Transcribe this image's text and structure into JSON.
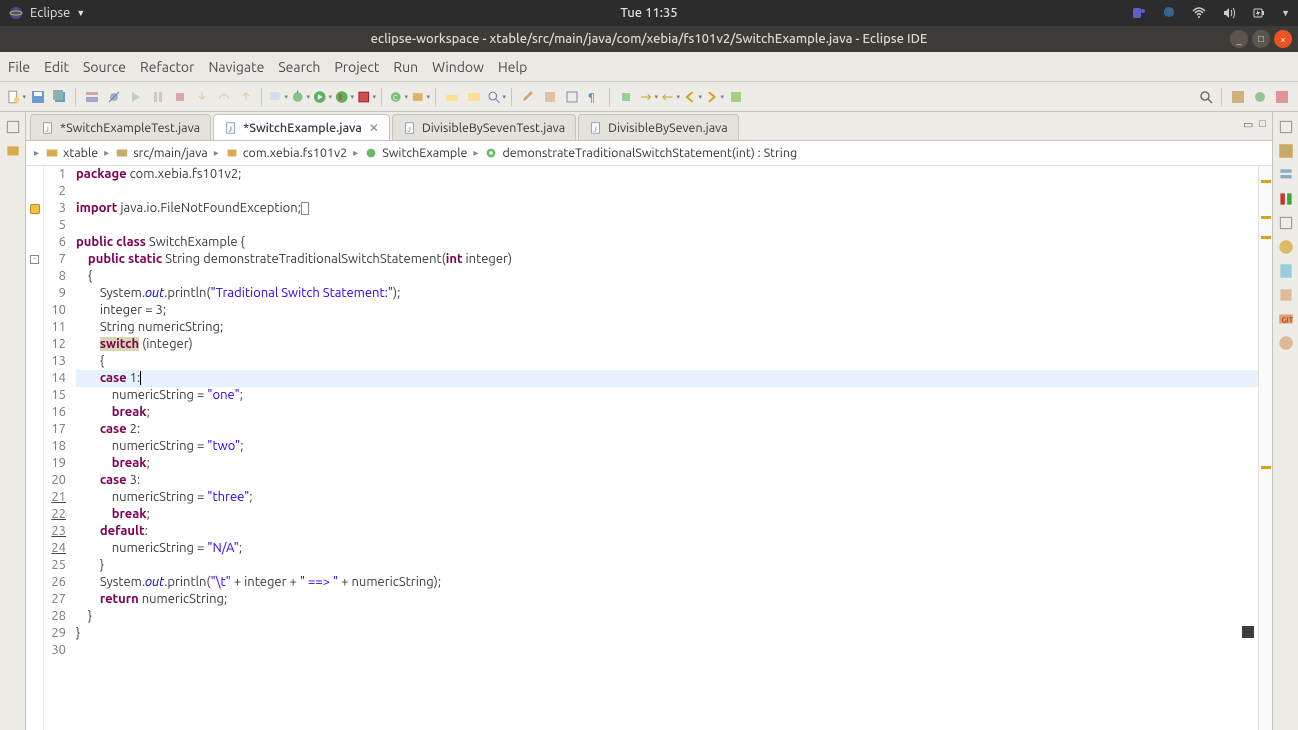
{
  "topbar": {
    "app": "Eclipse",
    "clock": "Tue 11:35"
  },
  "window": {
    "title": "eclipse-workspace - xtable/src/main/java/com/xebia/fs101v2/SwitchExample.java - Eclipse IDE"
  },
  "menu": [
    "File",
    "Edit",
    "Source",
    "Refactor",
    "Navigate",
    "Search",
    "Project",
    "Run",
    "Window",
    "Help"
  ],
  "tabs": [
    {
      "label": "*SwitchExampleTest.java",
      "active": false
    },
    {
      "label": "*SwitchExample.java",
      "active": true
    },
    {
      "label": "DivisibleBySevenTest.java",
      "active": false
    },
    {
      "label": "DivisibleBySeven.java",
      "active": false
    }
  ],
  "breadcrumb": {
    "project": "xtable",
    "srcfolder": "src/main/java",
    "pkg": "com.xebia.fs101v2",
    "cls": "SwitchExample",
    "method": "demonstrateTraditionalSwitchStatement(int) : String"
  },
  "code": {
    "lines": [
      {
        "n": 1,
        "tokens": [
          [
            "kw",
            "package"
          ],
          [
            "",
            " com.xebia.fs101v2;"
          ]
        ]
      },
      {
        "n": 2,
        "tokens": [
          [
            "",
            ""
          ]
        ]
      },
      {
        "n": 3,
        "marker": "warn-plus",
        "tokens": [
          [
            "kw",
            "import"
          ],
          [
            "",
            " java.io.FileNotFoundException;"
          ],
          [
            "box",
            "▯"
          ]
        ]
      },
      {
        "n": 5,
        "tokens": [
          [
            "",
            ""
          ]
        ]
      },
      {
        "n": 6,
        "tokens": [
          [
            "kw",
            "public"
          ],
          [
            "",
            " "
          ],
          [
            "kw",
            "class"
          ],
          [
            "",
            " SwitchExample {"
          ]
        ]
      },
      {
        "n": 7,
        "marker": "fold",
        "tokens": [
          [
            "",
            "    "
          ],
          [
            "kw",
            "public"
          ],
          [
            "",
            " "
          ],
          [
            "kw",
            "static"
          ],
          [
            "",
            " String demonstrateTraditionalSwitchStatement("
          ],
          [
            "kw",
            "int"
          ],
          [
            "",
            " integer)"
          ]
        ]
      },
      {
        "n": 8,
        "tokens": [
          [
            "",
            "    {"
          ]
        ]
      },
      {
        "n": 9,
        "tokens": [
          [
            "",
            "        System."
          ],
          [
            "fld",
            "out"
          ],
          [
            "",
            ".println("
          ],
          [
            "str",
            "\"Traditional Switch Statement:\""
          ],
          [
            "",
            ");"
          ]
        ]
      },
      {
        "n": 10,
        "tokens": [
          [
            "",
            "        integer = 3;"
          ]
        ]
      },
      {
        "n": 11,
        "tokens": [
          [
            "",
            "        String numericString;"
          ]
        ]
      },
      {
        "n": 12,
        "tokens": [
          [
            "",
            "        "
          ],
          [
            "switchbox",
            "switch"
          ],
          [
            "",
            " (integer)"
          ]
        ]
      },
      {
        "n": 13,
        "tokens": [
          [
            "",
            "        {"
          ]
        ]
      },
      {
        "n": 14,
        "hl": true,
        "tokens": [
          [
            "",
            "        "
          ],
          [
            "kw",
            "case"
          ],
          [
            "",
            " 1:"
          ],
          [
            "cursor",
            "|"
          ]
        ]
      },
      {
        "n": 15,
        "tokens": [
          [
            "",
            "            numericString = "
          ],
          [
            "str",
            "\"one\""
          ],
          [
            "",
            ";"
          ]
        ]
      },
      {
        "n": 16,
        "tokens": [
          [
            "",
            "            "
          ],
          [
            "kw",
            "break"
          ],
          [
            "",
            ";"
          ]
        ]
      },
      {
        "n": 17,
        "tokens": [
          [
            "",
            "        "
          ],
          [
            "kw",
            "case"
          ],
          [
            "",
            " 2:"
          ]
        ]
      },
      {
        "n": 18,
        "tokens": [
          [
            "",
            "            numericString = "
          ],
          [
            "str",
            "\"two\""
          ],
          [
            "",
            ";"
          ]
        ]
      },
      {
        "n": 19,
        "tokens": [
          [
            "",
            "            "
          ],
          [
            "kw",
            "break"
          ],
          [
            "",
            ";"
          ]
        ]
      },
      {
        "n": 20,
        "tokens": [
          [
            "",
            "        "
          ],
          [
            "kw",
            "case"
          ],
          [
            "",
            " 3:"
          ]
        ]
      },
      {
        "n": 21,
        "tokens": [
          [
            "",
            "            numericString = "
          ],
          [
            "str",
            "\"three\""
          ],
          [
            "",
            ";"
          ]
        ]
      },
      {
        "n": 22,
        "tokens": [
          [
            "",
            "            "
          ],
          [
            "kw",
            "break"
          ],
          [
            "",
            ";"
          ]
        ]
      },
      {
        "n": 23,
        "tokens": [
          [
            "",
            "        "
          ],
          [
            "kw",
            "default"
          ],
          [
            "",
            ":"
          ]
        ]
      },
      {
        "n": 24,
        "tokens": [
          [
            "",
            "            numericString = "
          ],
          [
            "str",
            "\"N/A\""
          ],
          [
            "",
            ";"
          ]
        ]
      },
      {
        "n": 25,
        "tokens": [
          [
            "",
            "        }"
          ]
        ]
      },
      {
        "n": 26,
        "tokens": [
          [
            "",
            "        System."
          ],
          [
            "fld",
            "out"
          ],
          [
            "",
            ".println("
          ],
          [
            "str",
            "\"\\t\""
          ],
          [
            "",
            " + integer + "
          ],
          [
            "str",
            "\" ==> \""
          ],
          [
            "",
            " + numericString);"
          ]
        ]
      },
      {
        "n": 27,
        "tokens": [
          [
            "",
            "        "
          ],
          [
            "kw",
            "return"
          ],
          [
            "",
            " numericString;"
          ]
        ]
      },
      {
        "n": 28,
        "tokens": [
          [
            "",
            "    }"
          ]
        ]
      },
      {
        "n": 29,
        "tokens": [
          [
            "",
            "}"
          ]
        ]
      },
      {
        "n": 30,
        "tokens": [
          [
            "",
            ""
          ]
        ]
      }
    ],
    "underlined": [
      21,
      22,
      23,
      24
    ]
  }
}
